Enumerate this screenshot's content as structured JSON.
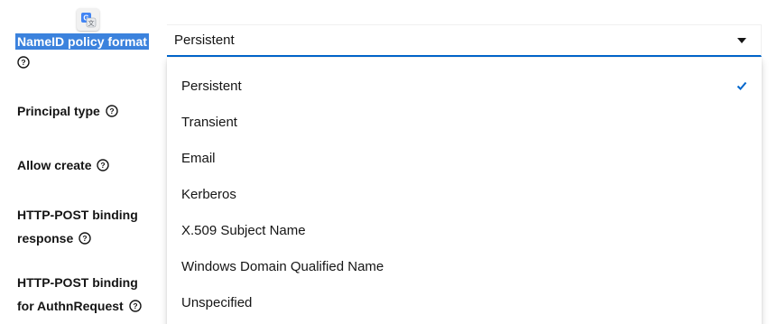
{
  "form": {
    "fields": [
      {
        "label": "NameID policy format"
      },
      {
        "label": "Principal type"
      },
      {
        "label": "Allow create"
      },
      {
        "label_line1": "HTTP-POST binding",
        "label_line2": "response"
      },
      {
        "label_line1": "HTTP-POST binding",
        "label_line2": "for AuthnRequest"
      }
    ]
  },
  "select": {
    "value": "Persistent",
    "options": [
      "Persistent",
      "Transient",
      "Email",
      "Kerberos",
      "X.509 Subject Name",
      "Windows Domain Qualified Name",
      "Unspecified"
    ],
    "selected_index": 0
  },
  "icons": {
    "translate": "google-translate-icon",
    "help": "question-circle-icon",
    "caret": "caret-down-icon",
    "check": "check-icon"
  },
  "colors": {
    "accent": "#0066cc",
    "highlight": "#3b82dd",
    "text": "#151515"
  }
}
